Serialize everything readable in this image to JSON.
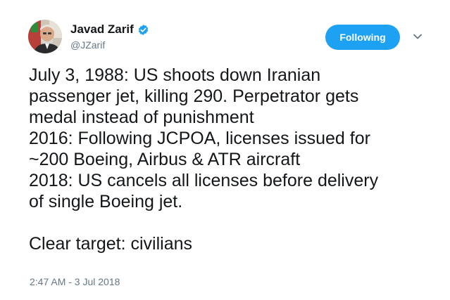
{
  "author": {
    "display_name": "Javad Zarif",
    "handle": "@JZarif",
    "verified": true
  },
  "follow_button": {
    "label": "Following"
  },
  "tweet": {
    "lines": [
      "July 3, 1988: US shoots down Iranian",
      "passenger jet, killing 290. Perpetrator gets",
      "medal instead of punishment",
      "2016: Following JCPOA, licenses issued for",
      "~200 Boeing, Airbus & ATR aircraft",
      "2018: US cancels all licenses before delivery",
      "of single Boeing jet."
    ],
    "closing": "Clear target: civilians",
    "timestamp": "2:47 AM - 3 Jul 2018"
  },
  "colors": {
    "accent": "#1da1f2",
    "text": "#14171a",
    "secondary": "#657786"
  },
  "icons": {
    "verified": "verified-badge-icon",
    "caret": "chevron-down-icon"
  }
}
